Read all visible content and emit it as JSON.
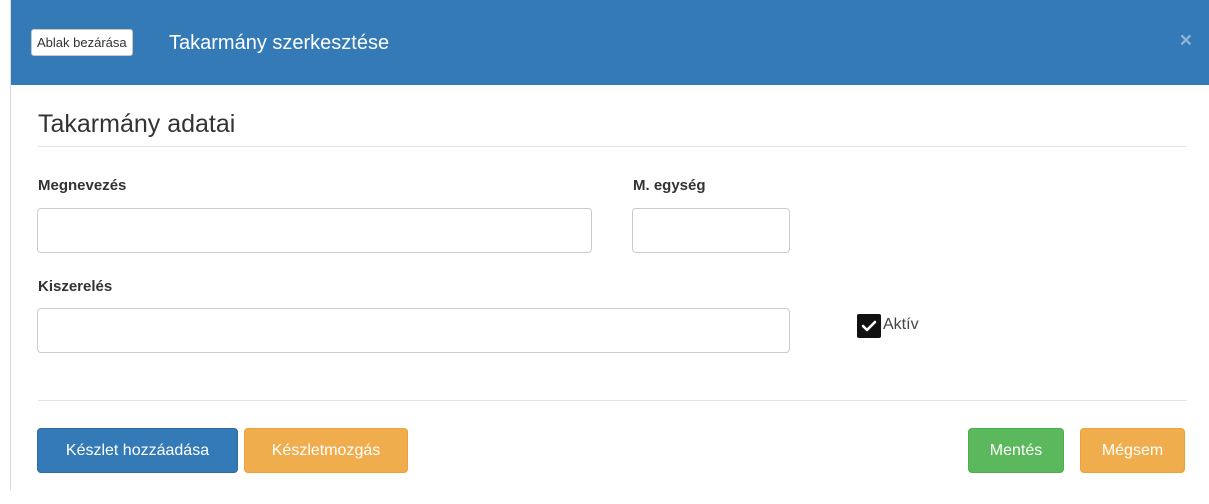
{
  "header": {
    "close_window_label": "Ablak bezárása",
    "title": "Takarmány szerkesztése",
    "close_x": "×"
  },
  "section": {
    "title": "Takarmány adatai"
  },
  "fields": {
    "name_label": "Megnevezés",
    "name_value": "",
    "unit_label": "M. egység",
    "unit_value": "",
    "packaging_label": "Kiszerelés",
    "packaging_value": ""
  },
  "active_checkbox": {
    "label": "Aktív",
    "checked": true
  },
  "buttons": {
    "add_stock": "Készlet hozzáadása",
    "stock_movement": "Készletmozgás",
    "save": "Mentés",
    "cancel": "Mégsem"
  },
  "colors": {
    "header_bg": "#337ab7",
    "primary": "#337ab7",
    "warning": "#f0ad4e",
    "success": "#5cb85c"
  }
}
